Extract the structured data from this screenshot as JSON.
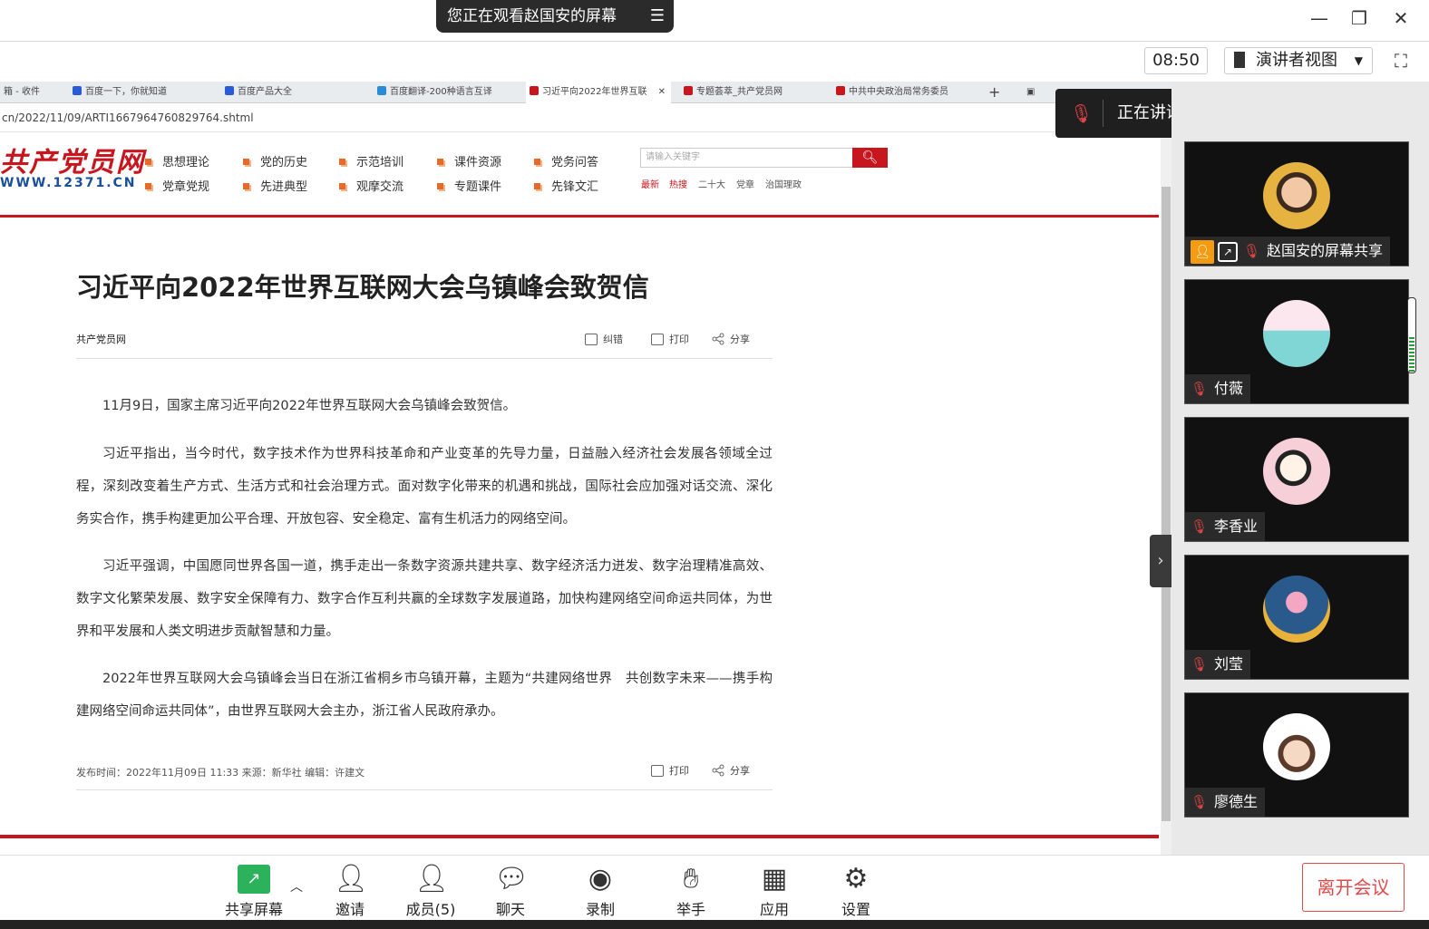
{
  "meeting": {
    "banner": "您正在观看赵国安的屏幕",
    "clock": "08:50",
    "view_mode": "演讲者视图",
    "speaking_label": "正在讲话:"
  },
  "browser": {
    "tabs": [
      {
        "label": "箱 - 收件",
        "color": "#2a6fd6"
      },
      {
        "label": "百度一下，你就知道",
        "color": "#2a5bd7"
      },
      {
        "label": "百度产品大全",
        "color": "#2a5bd7"
      },
      {
        "label": "百度翻译-200种语言互译",
        "color": "#2a8bd7"
      },
      {
        "label": "习近平向2022年世界互联",
        "color": "#c8161e"
      },
      {
        "label": "专题荟萃_共产党员网",
        "color": "#c8161e"
      },
      {
        "label": "中共中央政治局常务委员",
        "color": "#c8161e"
      }
    ],
    "address": "cn/2022/11/09/ARTI1667964760829764.shtml"
  },
  "site": {
    "logo_text": "共产党员网",
    "logo_url": "WWW.12371.CN",
    "nav": [
      [
        "思想理论",
        "党的历史",
        "示范培训",
        "课件资源",
        "党务问答"
      ],
      [
        "党章党规",
        "先进典型",
        "观摩交流",
        "专题课件",
        "先锋文汇"
      ]
    ],
    "search_placeholder": "请输入关键字",
    "hot_tags": [
      "最新",
      "热搜",
      "二十大",
      "党章",
      "治国理政"
    ]
  },
  "article": {
    "title": "习近平向2022年世界互联网大会乌镇峰会致贺信",
    "source": "共产党员网",
    "tools": {
      "correct": "纠错",
      "print": "打印",
      "share": "分享"
    },
    "paragraphs": [
      "11月9日，国家主席习近平向2022年世界互联网大会乌镇峰会致贺信。",
      "习近平指出，当今时代，数字技术作为世界科技革命和产业变革的先导力量，日益融入经济社会发展各领域全过程，深刻改变着生产方式、生活方式和社会治理方式。面对数字化带来的机遇和挑战，国际社会应加强对话交流、深化务实合作，携手构建更加公平合理、开放包容、安全稳定、富有生机活力的网络空间。",
      "习近平强调，中国愿同世界各国一道，携手走出一条数字资源共建共享、数字经济活力迸发、数字治理精准高效、数字文化繁荣发展、数字安全保障有力、数字合作互利共赢的全球数字发展道路，加快构建网络空间命运共同体，为世界和平发展和人类文明进步贡献智慧和力量。",
      "2022年世界互联网大会乌镇峰会当日在浙江省桐乡市乌镇开幕，主题为“共建网络世界　共创数字未来——携手构建网络空间命运共同体”，由世界互联网大会主办，浙江省人民政府承办。"
    ],
    "footer_meta": "发布时间：2022年11月09日 11:33 来源：新华社 编辑：许建文"
  },
  "participants": [
    {
      "name": "赵国安的屏幕共享"
    },
    {
      "name": "付薇"
    },
    {
      "name": "李香业"
    },
    {
      "name": "刘莹"
    },
    {
      "name": "廖德生"
    }
  ],
  "toolbar": {
    "share": "共享屏幕",
    "invite": "邀请",
    "members": "成员(5)",
    "chat": "聊天",
    "record": "录制",
    "raise": "举手",
    "apps": "应用",
    "settings": "设置",
    "leave": "离开会议"
  }
}
